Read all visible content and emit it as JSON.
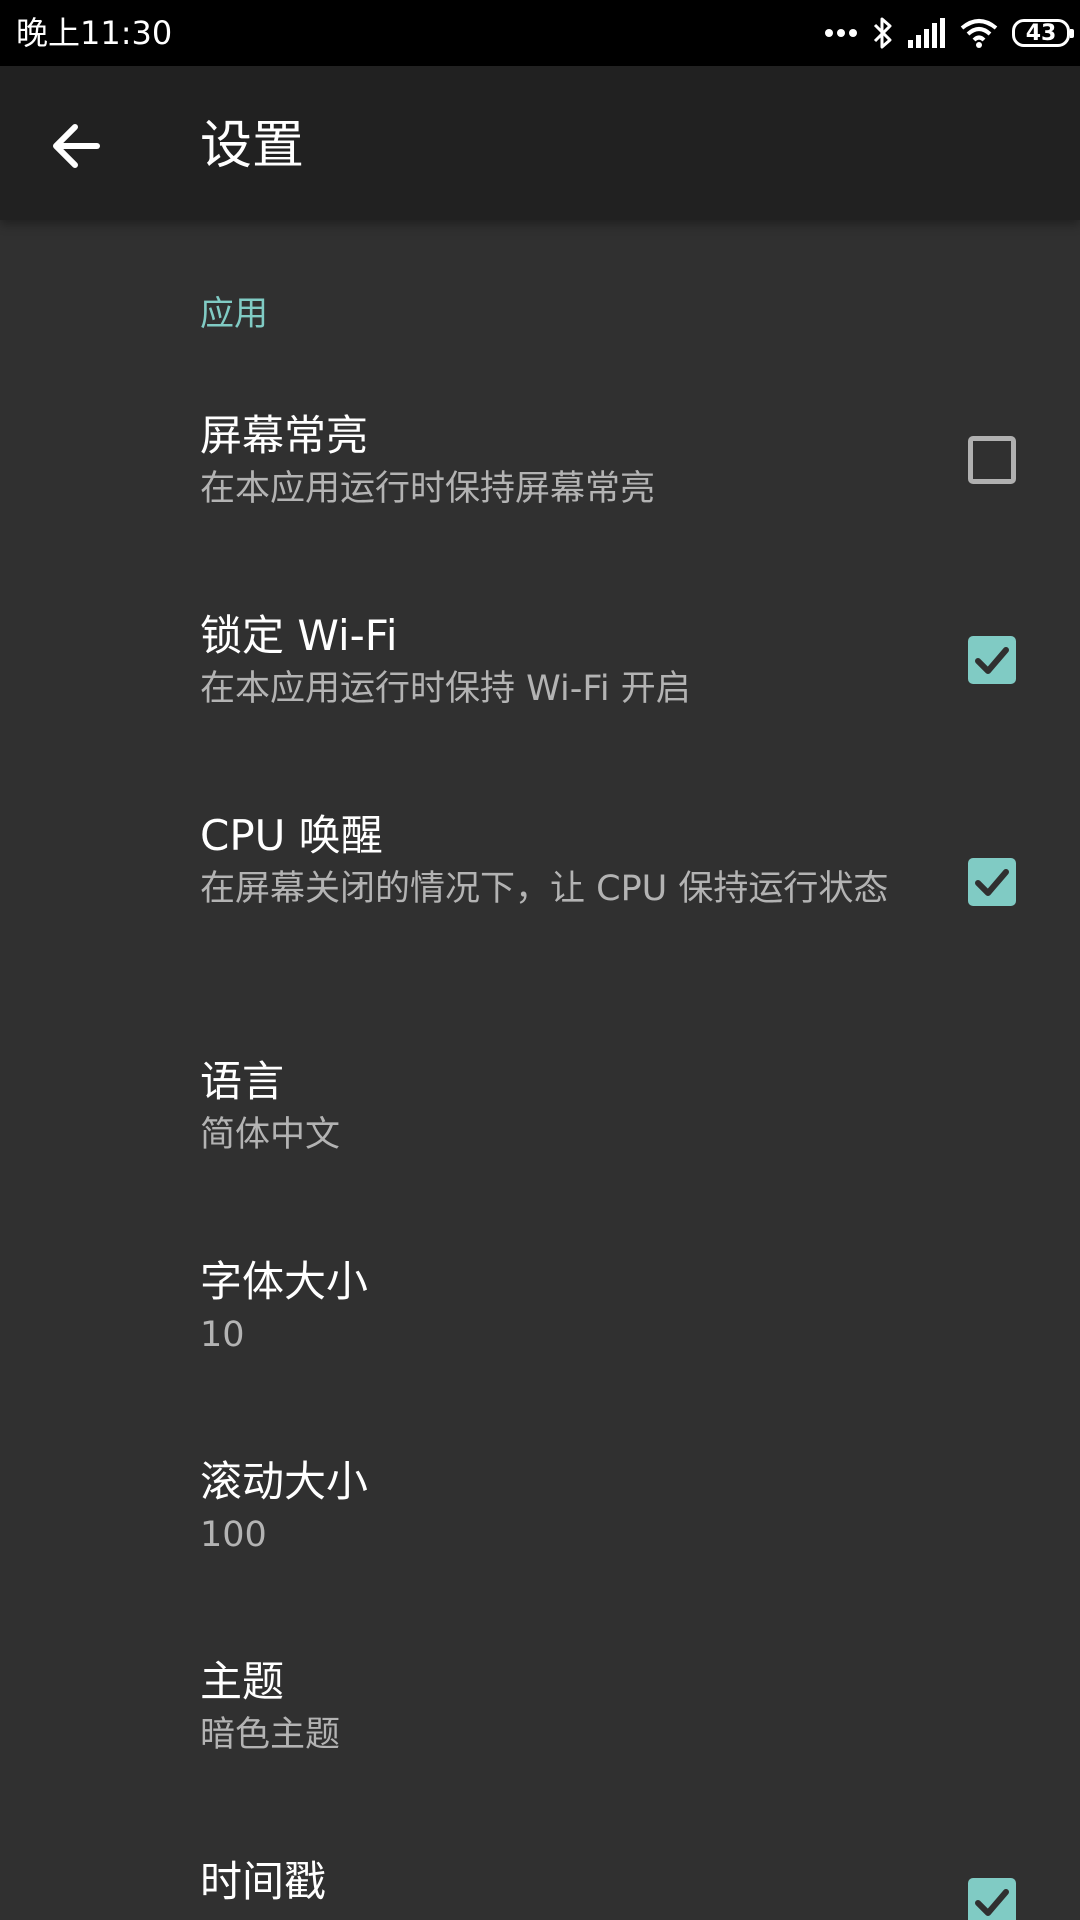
{
  "status_bar": {
    "time": "晚上11:30",
    "battery": "43",
    "icons": [
      "more-dots-icon",
      "bluetooth-icon",
      "signal-icon",
      "wifi-icon",
      "battery-icon"
    ]
  },
  "app_bar": {
    "back_icon": "arrow-left-icon",
    "title": "设置"
  },
  "section": {
    "title": "应用"
  },
  "preferences": [
    {
      "title": "屏幕常亮",
      "summary": "在本应用运行时保持屏幕常亮",
      "checked": false
    },
    {
      "title": "锁定 Wi-Fi",
      "summary": "在本应用运行时保持 Wi-Fi 开启",
      "checked": true
    },
    {
      "title": "CPU 唤醒",
      "summary": "在屏幕关闭的情况下，让 CPU 保持运行状态",
      "checked": true
    },
    {
      "title": "语言",
      "summary": "简体中文"
    },
    {
      "title": "字体大小",
      "summary": "10"
    },
    {
      "title": "滚动大小",
      "summary": "100"
    },
    {
      "title": "主题",
      "summary": "暗色主题"
    },
    {
      "title": "时间戳",
      "checked": true
    }
  ],
  "colors": {
    "accent": "#80cbc4",
    "background": "#303030",
    "app_bar": "#212121",
    "status_bar": "#000000"
  }
}
